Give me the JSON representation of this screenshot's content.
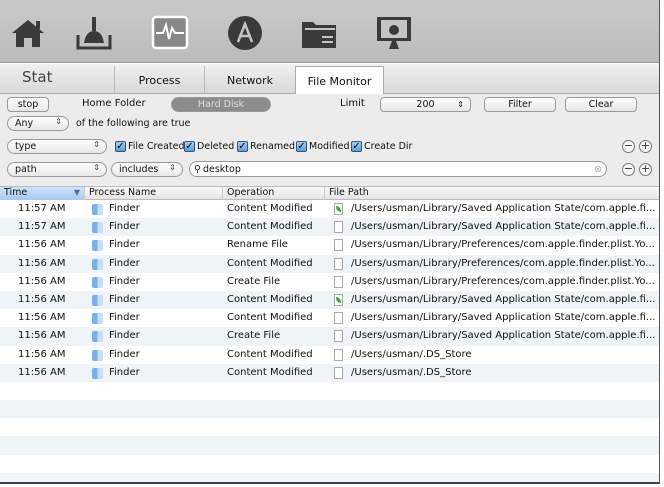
{
  "toolbar": {
    "items": [
      {
        "icon": "home-icon"
      },
      {
        "icon": "broom-icon"
      },
      {
        "icon": "activity-monitor-icon",
        "active": true
      },
      {
        "icon": "app-store-icon"
      },
      {
        "icon": "folder-icon"
      },
      {
        "icon": "mac-display-icon"
      }
    ]
  },
  "tabs": {
    "title": "Stat",
    "items": [
      "Process",
      "Network",
      "File Monitor"
    ],
    "active": "File Monitor"
  },
  "controls": {
    "stop": "stop",
    "home_folder": "Home Folder",
    "hard_disk": "Hard Disk",
    "limit_label": "Limit",
    "limit_value": "200",
    "filter": "Filter",
    "clear": "Clear",
    "match": "Any",
    "match_suffix": "of the following are true",
    "rule1": {
      "field": "type",
      "checks": [
        "File Created",
        "Deleted",
        "Renamed",
        "Modified",
        "Create Dir"
      ]
    },
    "rule2": {
      "field": "path",
      "op": "includes",
      "value": "desktop"
    }
  },
  "table": {
    "columns": [
      "Time",
      "Process Name",
      "Operation",
      "File Path"
    ],
    "rows": [
      {
        "time": "11:57 AM",
        "process": "Finder",
        "op": "Content Modified",
        "path": "/Users/usman/Library/Saved Application State/com.apple.fi...",
        "leaf": true
      },
      {
        "time": "11:57 AM",
        "process": "Finder",
        "op": "Content Modified",
        "path": "/Users/usman/Library/Saved Application State/com.apple.fi..."
      },
      {
        "time": "11:56 AM",
        "process": "Finder",
        "op": "Rename File",
        "path": "/Users/usman/Library/Preferences/com.apple.finder.plist.Yo..."
      },
      {
        "time": "11:56 AM",
        "process": "Finder",
        "op": "Content Modified",
        "path": "/Users/usman/Library/Preferences/com.apple.finder.plist.Yo..."
      },
      {
        "time": "11:56 AM",
        "process": "Finder",
        "op": "Create File",
        "path": "/Users/usman/Library/Preferences/com.apple.finder.plist.Yo..."
      },
      {
        "time": "11:56 AM",
        "process": "Finder",
        "op": "Content Modified",
        "path": "/Users/usman/Library/Saved Application State/com.apple.fi...",
        "leaf": true
      },
      {
        "time": "11:56 AM",
        "process": "Finder",
        "op": "Content Modified",
        "path": "/Users/usman/Library/Saved Application State/com.apple.fi..."
      },
      {
        "time": "11:56 AM",
        "process": "Finder",
        "op": "Create File",
        "path": "/Users/usman/Library/Saved Application State/com.apple.fi..."
      },
      {
        "time": "11:56 AM",
        "process": "Finder",
        "op": "Content Modified",
        "path": "/Users/usman/.DS_Store"
      },
      {
        "time": "11:56 AM",
        "process": "Finder",
        "op": "Content Modified",
        "path": "/Users/usman/.DS_Store"
      }
    ]
  }
}
